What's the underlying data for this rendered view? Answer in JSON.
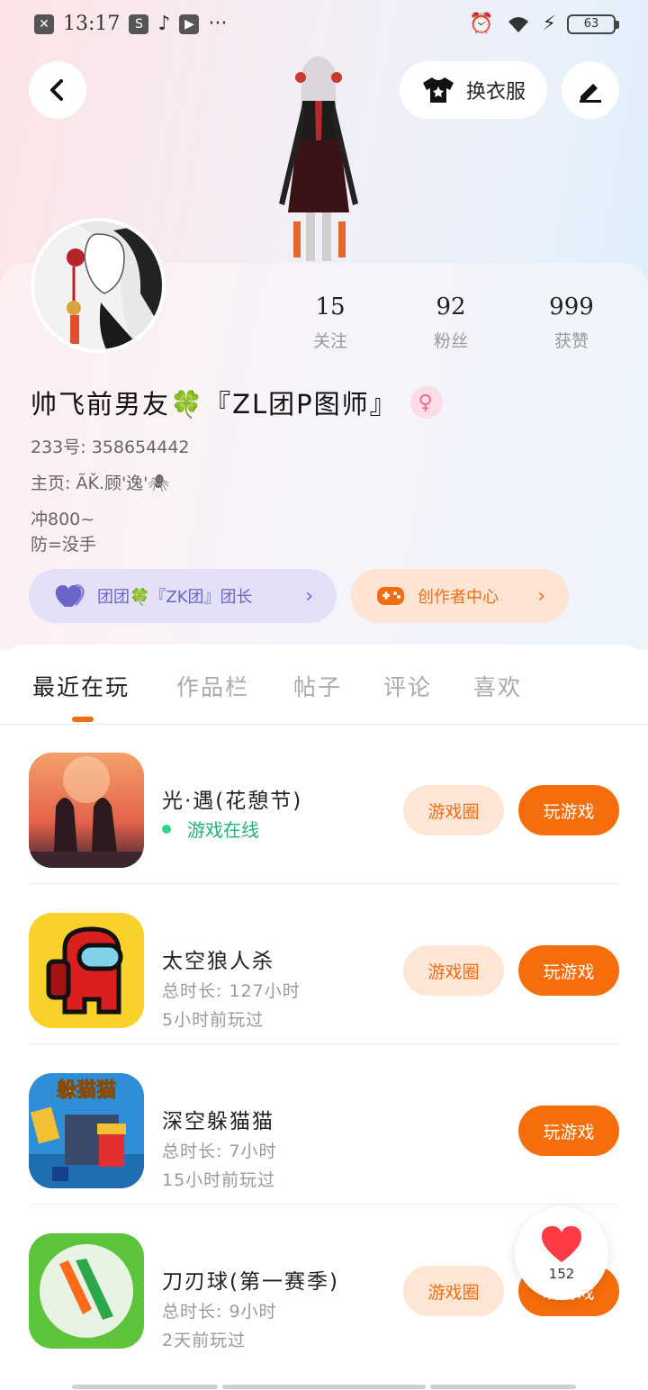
{
  "status_bar": {
    "time": "13:17",
    "battery": "63"
  },
  "header": {
    "dress_label": "换衣服"
  },
  "profile": {
    "stats": [
      {
        "num": "15",
        "label": "关注"
      },
      {
        "num": "92",
        "label": "粉丝"
      },
      {
        "num": "999",
        "label": "获赞"
      }
    ],
    "nickname": "帅飞前男友🍀『ZL团P图师』",
    "id_line": "233号: 358654442",
    "homepage_line": "主页: ÃǨ.顾'逸'🕷",
    "bio_line1": "冲800~",
    "bio_line2": "防=没手",
    "group_pill": "团团🍀『ZK团』团长",
    "creator_pill": "创作者中心"
  },
  "tabs": [
    "最近在玩",
    "作品栏",
    "帖子",
    "评论",
    "喜欢"
  ],
  "games": [
    {
      "name": "光·遇(花憩节)",
      "sub1": "游戏在线",
      "sub2": "",
      "online": true,
      "circle": "游戏圈",
      "play": "玩游戏"
    },
    {
      "name": "太空狼人杀",
      "sub1": "总时长: 127小时",
      "sub2": "5小时前玩过",
      "online": false,
      "circle": "游戏圈",
      "play": "玩游戏"
    },
    {
      "name": "深空躲猫猫",
      "sub1": "总时长: 7小时",
      "sub2": "15小时前玩过",
      "online": false,
      "circle": "",
      "play": "玩游戏",
      "icon_title": "躲猫猫"
    },
    {
      "name": "刀刃球(第一赛季)",
      "sub1": "总时长: 9小时",
      "sub2": "2天前玩过",
      "online": false,
      "circle": "游戏圈",
      "play": "玩游戏"
    }
  ],
  "like_float": {
    "count": "152"
  },
  "colors": {
    "accent": "#f66d0b",
    "online": "#20b573",
    "group_text": "#6a65c9"
  }
}
